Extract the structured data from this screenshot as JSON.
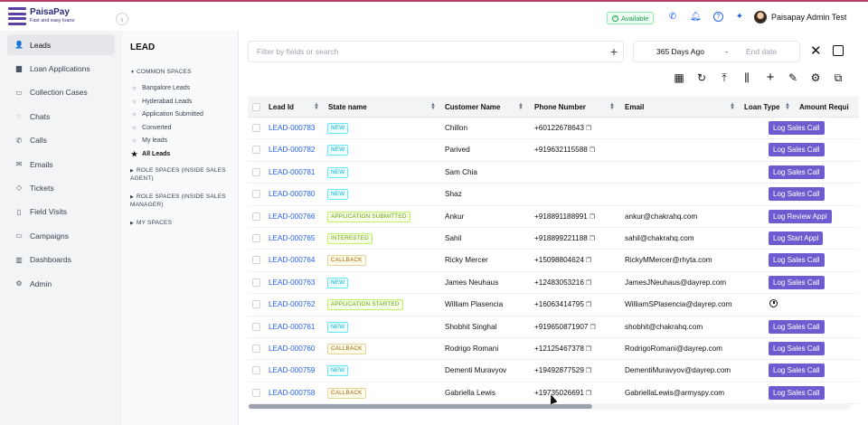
{
  "brand": {
    "name": "PaisaPay",
    "tagline": "Fast and easy loans"
  },
  "status": "Available",
  "user": {
    "name": "Paisapay Admin Test"
  },
  "nav": [
    {
      "label": "Leads",
      "icon": "person-icon",
      "glyph": "👤"
    },
    {
      "label": "Loan Applications",
      "icon": "folder-icon",
      "glyph": "▆"
    },
    {
      "label": "Collection Cases",
      "icon": "cases-icon",
      "glyph": "▭"
    },
    {
      "label": "Chats",
      "icon": "chat-icon",
      "glyph": "◌"
    },
    {
      "label": "Calls",
      "icon": "phone-icon",
      "glyph": "✆"
    },
    {
      "label": "Emails",
      "icon": "mail-icon",
      "glyph": "✉"
    },
    {
      "label": "Tickets",
      "icon": "ticket-icon",
      "glyph": "◇"
    },
    {
      "label": "Field Visits",
      "icon": "map-icon",
      "glyph": "▯"
    },
    {
      "label": "Campaigns",
      "icon": "campaign-icon",
      "glyph": "▭"
    },
    {
      "label": "Dashboards",
      "icon": "dashboard-icon",
      "glyph": "▥"
    },
    {
      "label": "Admin",
      "icon": "gear-icon",
      "glyph": "⚙"
    }
  ],
  "lead_panel": {
    "title": "LEAD",
    "common_spaces": "COMMON SPACES",
    "spaces": [
      "Bangalore Leads",
      "Hyderabad Leads",
      "Application Submitted",
      "Converted",
      "My leads",
      "All Leads"
    ],
    "role_agent": "ROLE SPACES (INSIDE SALES AGENT)",
    "role_manager": "ROLE SPACES (INSIDE SALES MANAGER)",
    "my_spaces": "MY SPACES"
  },
  "filter": {
    "placeholder": "Filter by fields or search"
  },
  "date_range": {
    "from": "365 Days Ago",
    "separator": "-",
    "to": "End date"
  },
  "columns": [
    "Lead Id",
    "State name",
    "Customer Name",
    "Phone Number",
    "Email",
    "Loan Type",
    "Amount Requi"
  ],
  "rows": [
    {
      "id": "LEAD-000783",
      "state": "NEW",
      "state_kind": "new",
      "name": "Chillon",
      "phone": "+60122678643",
      "email": "",
      "action": "Log Sales Call"
    },
    {
      "id": "LEAD-000782",
      "state": "NEW",
      "state_kind": "new",
      "name": "Parived",
      "phone": "+919632115588",
      "email": "",
      "action": "Log Sales Call"
    },
    {
      "id": "LEAD-000781",
      "state": "NEW",
      "state_kind": "new",
      "name": "Sam Chia",
      "phone": "",
      "email": "",
      "action": "Log Sales Call"
    },
    {
      "id": "LEAD-000780",
      "state": "NEW",
      "state_kind": "new",
      "name": "Shaz",
      "phone": "",
      "email": "",
      "action": "Log Sales Call"
    },
    {
      "id": "LEAD-000766",
      "state": "APPLICATION SUBMITTED",
      "state_kind": "app",
      "name": "Ankur",
      "phone": "+918891188991",
      "email": "ankur@chakrahq.com",
      "action": "Log Review Appl"
    },
    {
      "id": "LEAD-000765",
      "state": "INTERESTED",
      "state_kind": "int",
      "name": "Sahil",
      "phone": "+918899221188",
      "email": "sahil@chakrahq.com",
      "action": "Log Start Appl"
    },
    {
      "id": "LEAD-000764",
      "state": "CALLBACK",
      "state_kind": "cb",
      "name": "Ricky Mercer",
      "phone": "+15098804624",
      "email": "RickyMMercer@rhyta.com",
      "action": "Log Sales Call"
    },
    {
      "id": "LEAD-000763",
      "state": "NEW",
      "state_kind": "new",
      "name": "James Neuhaus",
      "phone": "+12483053216",
      "email": "JamesJNeuhaus@dayrep.com",
      "action": "Log Sales Call"
    },
    {
      "id": "LEAD-000762",
      "state": "APPLICATION STARTED",
      "state_kind": "app",
      "name": "William Plasencia",
      "phone": "+16063414795",
      "email": "WilliamSPlasencia@dayrep.com",
      "action": ""
    },
    {
      "id": "LEAD-000761",
      "state": "NEW",
      "state_kind": "new",
      "name": "Shobhit Singhal",
      "phone": "+919650871907",
      "email": "shobhit@chakrahq.com",
      "action": "Log Sales Call"
    },
    {
      "id": "LEAD-000760",
      "state": "CALLBACK",
      "state_kind": "cb",
      "name": "Rodrigo Romani",
      "phone": "+12125467378",
      "email": "RodrigoRomani@dayrep.com",
      "action": "Log Sales Call"
    },
    {
      "id": "LEAD-000759",
      "state": "NEW",
      "state_kind": "new",
      "name": "Dementi Muravyov",
      "phone": "+19492877529",
      "email": "DementiMuravyov@dayrep.com",
      "action": "Log Sales Call"
    },
    {
      "id": "LEAD-000758",
      "state": "CALLBACK",
      "state_kind": "cb",
      "name": "Gabriella Lewis",
      "phone": "+19735026691",
      "email": "GabriellaLewis@armyspy.com",
      "action": "Log Sales Call"
    }
  ]
}
